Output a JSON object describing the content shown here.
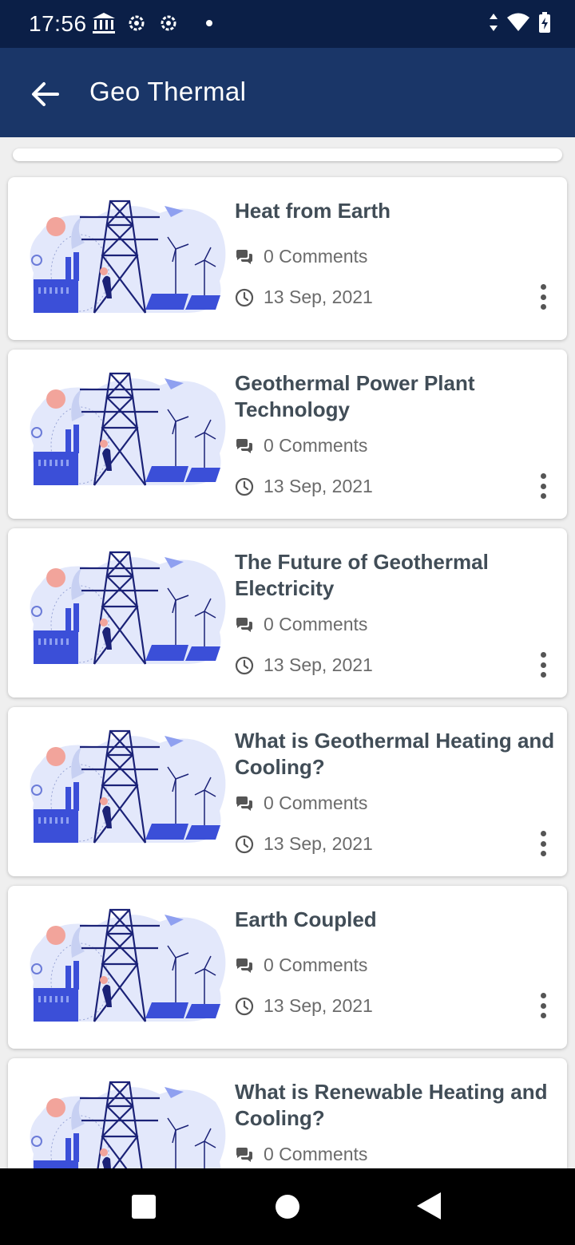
{
  "status_bar": {
    "time": "17:56"
  },
  "app_bar": {
    "title": "Geo Thermal"
  },
  "articles": [
    {
      "title": "Heat from Earth",
      "comments": "0 Comments",
      "date": "13 Sep, 2021"
    },
    {
      "title": "Geothermal Power Plant Technology",
      "comments": "0 Comments",
      "date": "13 Sep, 2021"
    },
    {
      "title": "The Future of Geothermal Electricity",
      "comments": "0 Comments",
      "date": "13 Sep, 2021"
    },
    {
      "title": "What is Geothermal Heating and Cooling?",
      "comments": "0 Comments",
      "date": "13 Sep, 2021"
    },
    {
      "title": "Earth Coupled",
      "comments": "0 Comments",
      "date": "13 Sep, 2021"
    },
    {
      "title": "What is Renewable Heating and Cooling?",
      "comments": "0 Comments",
      "date": ""
    }
  ],
  "colors": {
    "status_bar": "#0b1f47",
    "app_bar": "#1a3668",
    "title_text": "#414d57"
  }
}
